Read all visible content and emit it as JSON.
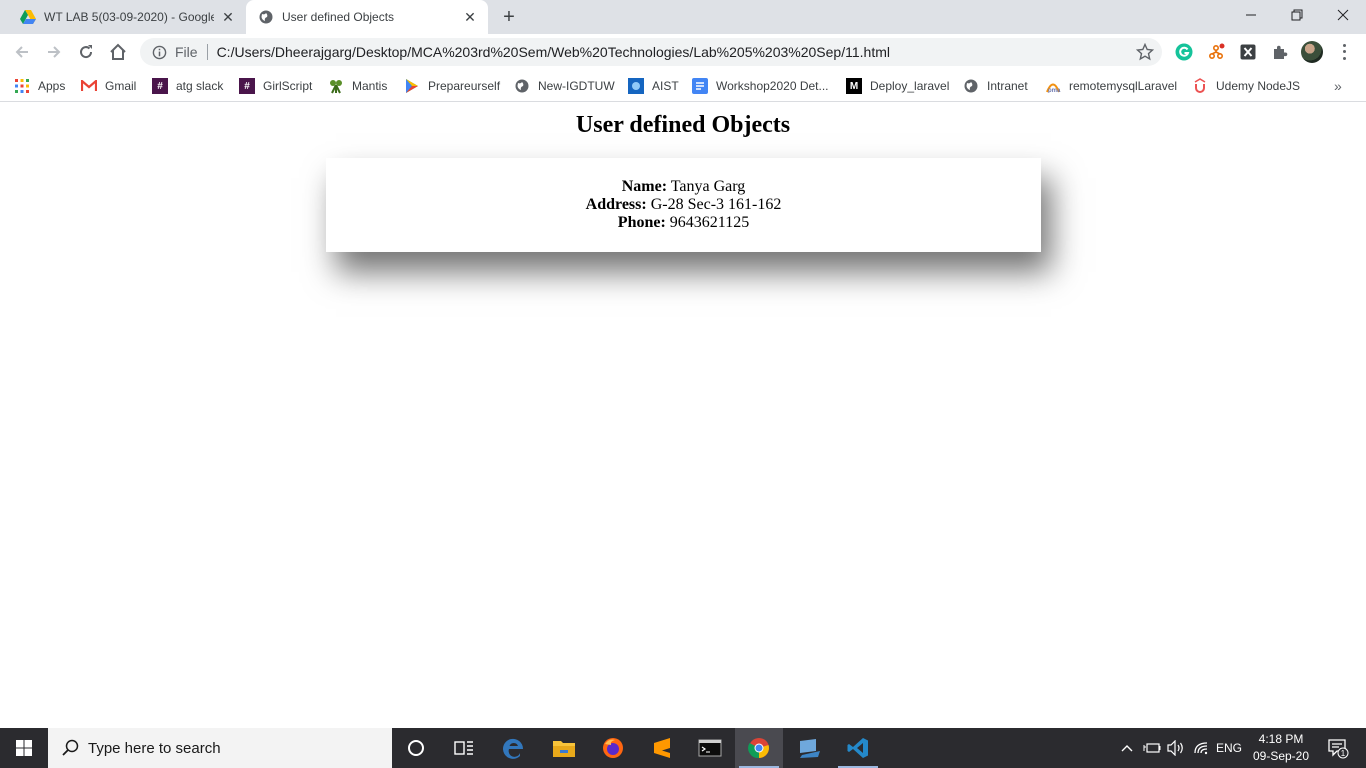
{
  "browser": {
    "tabs": [
      {
        "title": "WT LAB 5(03-09-2020) - Google",
        "favicon": "google-drive-icon",
        "active": false
      },
      {
        "title": "User defined Objects",
        "favicon": "globe-icon",
        "active": true
      }
    ],
    "new_tab_label": "+",
    "scheme": "File",
    "url": "C:/Users/Dheerajgarg/Desktop/MCA%203rd%20Sem/Web%20Technologies/Lab%205%203%20Sep/11.html",
    "bookmarks": [
      {
        "label": "Apps",
        "icon": "apps-grid-icon",
        "color": "#ea4335"
      },
      {
        "label": "Gmail",
        "icon": "gmail-icon",
        "color": "#ea4335"
      },
      {
        "label": "atg slack",
        "icon": "slack-icon",
        "color": "#4a154b"
      },
      {
        "label": "GirlScript",
        "icon": "slack-icon",
        "color": "#4a154b"
      },
      {
        "label": "Mantis",
        "icon": "mantis-icon",
        "color": "#5a8f29"
      },
      {
        "label": "Prepareurself",
        "icon": "play-icon",
        "color": "#34a853"
      },
      {
        "label": "New-IGDTUW",
        "icon": "globe-icon",
        "color": "#5f6368"
      },
      {
        "label": "AIST",
        "icon": "aist-icon",
        "color": "#1565c0"
      },
      {
        "label": "Workshop2020 Det...",
        "icon": "docs-icon",
        "color": "#4285f4"
      },
      {
        "label": "Deploy_laravel",
        "icon": "medium-icon",
        "color": "#000000"
      },
      {
        "label": "Intranet",
        "icon": "globe-icon",
        "color": "#5f6368"
      },
      {
        "label": "remotemysqlLaravel",
        "icon": "pma-icon",
        "color": "#f29111"
      },
      {
        "label": "Udemy NodeJS",
        "icon": "udemy-icon",
        "color": "#ec5252"
      }
    ]
  },
  "page": {
    "heading": "User defined Objects",
    "fields": [
      {
        "label": "Name:",
        "value": "Tanya Garg"
      },
      {
        "label": "Address:",
        "value": "G-28 Sec-3 161-162"
      },
      {
        "label": "Phone:",
        "value": "9643621125"
      }
    ]
  },
  "taskbar": {
    "search_placeholder": "Type here to search",
    "language": "ENG",
    "time": "4:18 PM",
    "date": "09-Sep-20",
    "notification_count": "1"
  }
}
